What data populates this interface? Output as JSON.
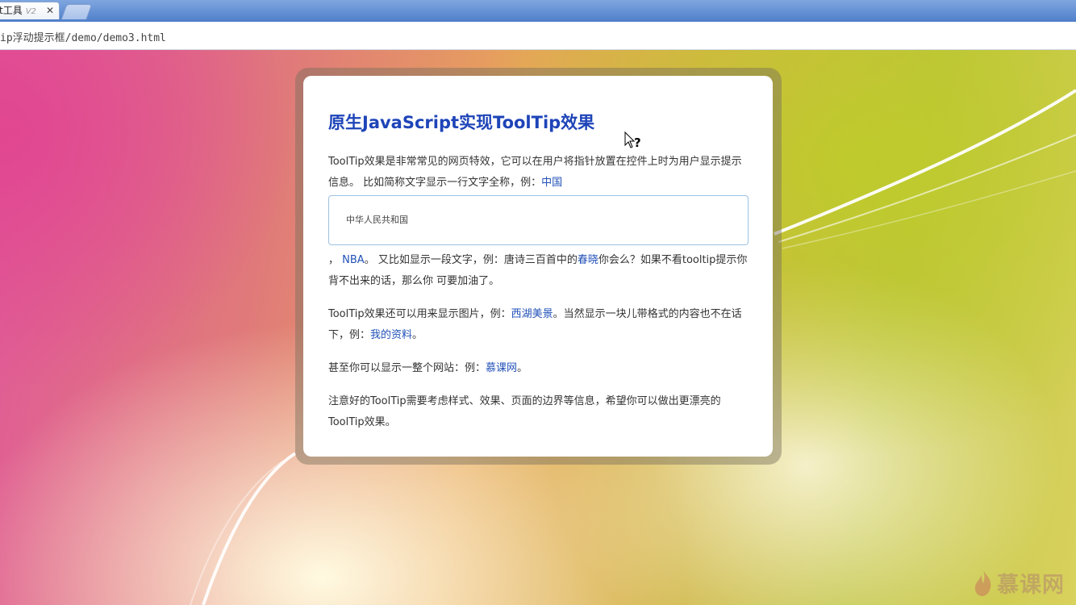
{
  "browser": {
    "tab_title": "t工具",
    "tab_version": "V2",
    "tab_close": "✕",
    "url": "ip浮动提示框/demo/demo3.html"
  },
  "card": {
    "title": "原生JavaScript实现ToolTip效果",
    "p1_text": "ToolTip效果是非常常见的网页特效，它可以在用户将指针放置在控件上时为用户显示提示信息。 比如简称文字显示一行文字全称，例：",
    "p1_link": "中国",
    "tooltip_text": "中华人民共和国",
    "p2_a": "， ",
    "p2_link_nba": "NBA",
    "p2_b": "。 又比如显示一段文字，例：唐诗三百首中的",
    "p2_link_poem": "春晓",
    "p2_c": "你会么？如果不看tooltip提示你背不出来的话，那么你 可要加油了。",
    "p3_a": "ToolTip效果还可以用来显示图片，例：",
    "p3_link_img": "西湖美景",
    "p3_b": "。当然显示一块儿带格式的内容也不在话下，例：",
    "p3_link_profile": "我的资料",
    "p3_c": "。",
    "p4_a": "甚至你可以显示一整个网站：例：",
    "p4_link_site": "慕课网",
    "p4_b": "。",
    "p5_text": "注意好的ToolTip需要考虑样式、效果、页面的边界等信息，希望你可以做出更漂亮的ToolTip效果。"
  },
  "cursor_icon": "help-cursor-icon",
  "watermark": "慕课网",
  "colors": {
    "title": "#1e44b8",
    "link": "#2251b8",
    "tooltip_border": "#9cc3e3"
  }
}
